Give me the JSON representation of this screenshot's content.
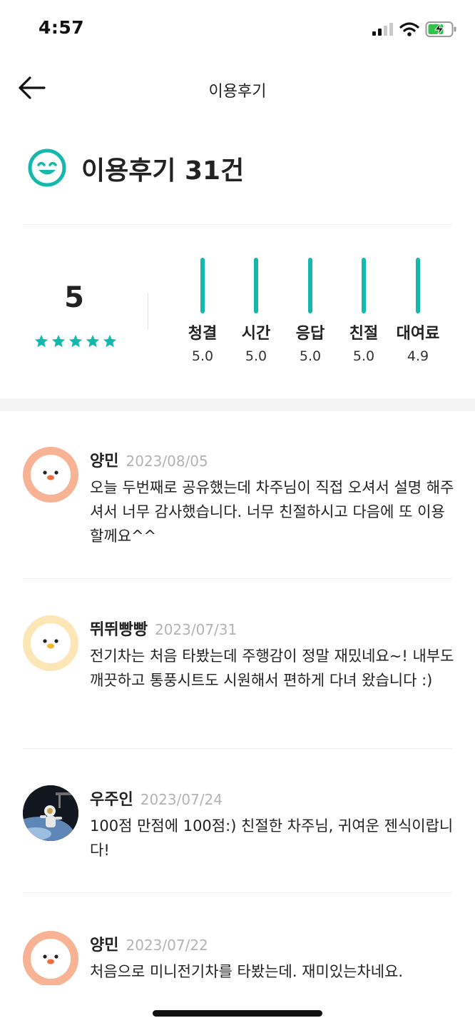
{
  "status_bar": {
    "time": "4:57"
  },
  "header": {
    "title": "이용후기"
  },
  "summary": {
    "heading": "이용후기 31건",
    "overall_score": "5",
    "stars": 5,
    "accent_color": "#15b8ac",
    "categories": [
      {
        "label": "청결",
        "value": "5.0"
      },
      {
        "label": "시간",
        "value": "5.0"
      },
      {
        "label": "응답",
        "value": "5.0"
      },
      {
        "label": "친절",
        "value": "5.0"
      },
      {
        "label": "대여료",
        "value": "4.9"
      }
    ]
  },
  "reviews": [
    {
      "name": "양민",
      "date": "2023/08/05",
      "text": "오늘 두번째로 공유했는데 차주님이 직접 오셔서 설명 해주셔서 너무 감사했습니다. 너무 친절하시고 다음에 또 이용할께요^^",
      "avatar": "chick-avatar-orange"
    },
    {
      "name": "뛰뛰빵빵",
      "date": "2023/07/31",
      "text": "전기차는 처음 타봤는데 주행감이 정말 재밌네요~! 내부도 깨끗하고 통풍시트도 시원해서 편하게 다녀 왔습니다 :)",
      "avatar": "chick-avatar-yellow"
    },
    {
      "name": "우주인",
      "date": "2023/07/24",
      "text": "100점 만점에 100점:) 친절한 차주님, 귀여운 젠식이랍니다!",
      "avatar": "astronaut-photo"
    },
    {
      "name": "양민",
      "date": "2023/07/22",
      "text": "처음으로 미니전기차를 타봤는데. 재미있는차네요.",
      "avatar": "chick-avatar-orange"
    }
  ]
}
